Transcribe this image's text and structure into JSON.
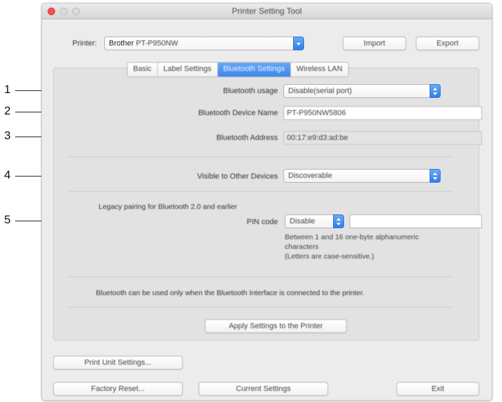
{
  "window": {
    "title": "Printer Setting Tool"
  },
  "printer": {
    "label": "Printer:",
    "selected_prefix": "Brother",
    "selected_model": "PT-P950NW"
  },
  "toolbar": {
    "import_label": "Import",
    "export_label": "Export"
  },
  "tabs": [
    {
      "label": "Basic",
      "active": false
    },
    {
      "label": "Label Settings",
      "active": false
    },
    {
      "label": "Bluetooth Settings",
      "active": true
    },
    {
      "label": "Wireless LAN",
      "active": false
    }
  ],
  "bluetooth": {
    "usage": {
      "label": "Bluetooth usage",
      "value": "Disable(serial port)"
    },
    "device_name": {
      "label": "Bluetooth Device Name",
      "value": "PT-P950NW5806"
    },
    "address": {
      "label": "Bluetooth Address",
      "value": "00:17:e9:d3:ad:be"
    },
    "visible": {
      "label": "Visible to Other Devices",
      "value": "Discoverable"
    },
    "legacy_heading": "Legacy pairing for Bluetooth 2.0 and earlier",
    "pin": {
      "label": "PIN code",
      "select_value": "Disable",
      "input_value": "",
      "help_lines": [
        "Between 1 and 16 one-byte alphanumeric",
        "characters",
        "(Letters are case-sensitive.)"
      ]
    },
    "note": "Bluetooth can be used only when the Bluetooth Interface is connected to the printer.",
    "apply_label": "Apply Settings to the Printer"
  },
  "footer": {
    "print_unit_label": "Print Unit Settings...",
    "factory_reset_label": "Factory Reset...",
    "current_settings_label": "Current Settings",
    "exit_label": "Exit"
  },
  "callouts": [
    "1",
    "2",
    "3",
    "4",
    "5"
  ],
  "colors": {
    "accent": "#3a86ec",
    "close": "#f1524f"
  }
}
